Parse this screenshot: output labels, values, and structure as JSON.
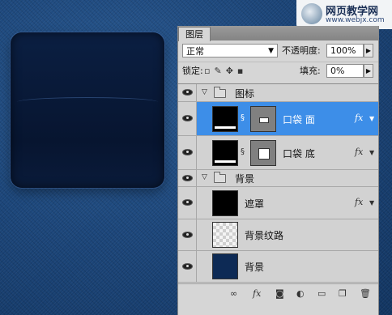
{
  "watermark": {
    "line1": "网页教学网",
    "line2": "www.webjx.com"
  },
  "panel": {
    "tab_label": "图层",
    "blend_mode": "正常",
    "opacity_label": "不透明度:",
    "opacity_value": "100%",
    "lock_label": "锁定:",
    "fill_label": "填充:",
    "fill_value": "0%",
    "lock_icons": [
      "lock-transparent-icon",
      "brush-icon",
      "move-icon",
      "lock-icon"
    ]
  },
  "layers": [
    {
      "type": "group",
      "name": "图标",
      "visible": true
    },
    {
      "type": "layer",
      "name": "口袋 面",
      "visible": true,
      "selected": true,
      "has_mask": true,
      "has_fx": true
    },
    {
      "type": "layer",
      "name": "口袋 底",
      "visible": true,
      "selected": false,
      "has_mask": true,
      "has_fx": true
    },
    {
      "type": "group",
      "name": "背景",
      "visible": true
    },
    {
      "type": "layer",
      "name": "遮罩",
      "visible": true,
      "selected": false,
      "has_fx": true
    },
    {
      "type": "layer",
      "name": "背景纹路",
      "visible": true,
      "selected": false
    },
    {
      "type": "layer",
      "name": "背景",
      "visible": true,
      "selected": false
    }
  ],
  "bottom_bar": [
    "link-layers-icon",
    "add-style-icon",
    "add-mask-icon",
    "adjustment-icon",
    "new-group-icon",
    "new-layer-icon",
    "delete-icon"
  ],
  "fx_glyph": "fx",
  "colors": {
    "selected_row": "#3d8ee8",
    "panel_bg": "#d6d6d6",
    "denim": "#1c467a"
  }
}
